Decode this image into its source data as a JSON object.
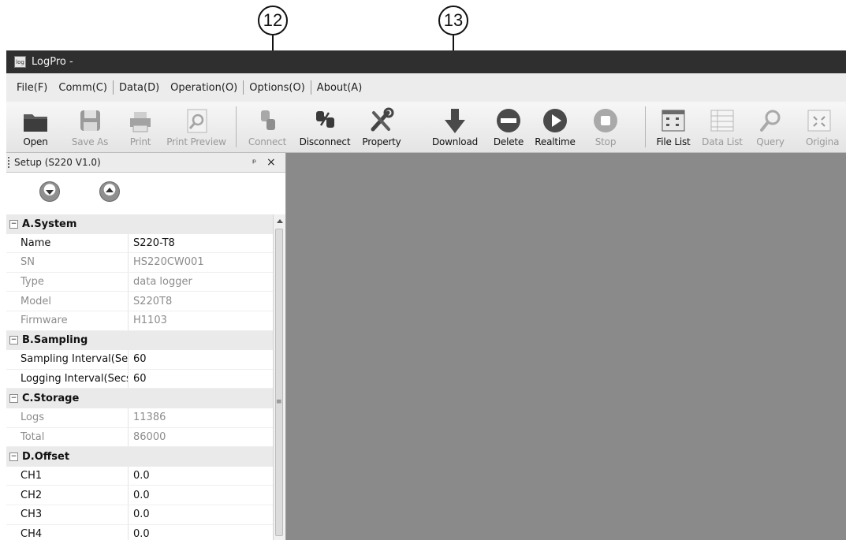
{
  "callouts": [
    {
      "label": "12"
    },
    {
      "label": "13"
    }
  ],
  "window": {
    "title": "LogPro -",
    "icon_text": "log"
  },
  "menu": [
    "File(F)",
    "Comm(C)",
    "Data(D)",
    "Operation(O)",
    "Options(O)",
    "About(A)"
  ],
  "toolbar": [
    {
      "label": "Open",
      "icon": "folder-icon",
      "enabled": true
    },
    {
      "label": "Save As",
      "icon": "save-icon",
      "enabled": false
    },
    {
      "label": "Print",
      "icon": "print-icon",
      "enabled": false
    },
    {
      "label": "Print Preview",
      "icon": "print-preview-icon",
      "enabled": false
    },
    {
      "label": "Connect",
      "icon": "connect-icon",
      "enabled": false
    },
    {
      "label": "Disconnect",
      "icon": "disconnect-icon",
      "enabled": true
    },
    {
      "label": "Property",
      "icon": "property-icon",
      "enabled": true
    },
    {
      "label": "Download",
      "icon": "download-icon",
      "enabled": true
    },
    {
      "label": "Delete",
      "icon": "delete-icon",
      "enabled": true
    },
    {
      "label": "Realtime",
      "icon": "realtime-icon",
      "enabled": true
    },
    {
      "label": "Stop",
      "icon": "stop-icon",
      "enabled": false
    },
    {
      "label": "File List",
      "icon": "file-list-icon",
      "enabled": true
    },
    {
      "label": "Data List",
      "icon": "data-list-icon",
      "enabled": false
    },
    {
      "label": "Query",
      "icon": "query-icon",
      "enabled": false
    },
    {
      "label": "Origina",
      "icon": "original-icon",
      "enabled": false
    }
  ],
  "panel": {
    "title": "Setup (S220 V1.0)",
    "pin_glyph": "ᵖ",
    "close_glyph": "×",
    "tools": [
      "read-settings-icon",
      "write-settings-icon"
    ]
  },
  "properties": [
    {
      "category": "A.System",
      "items": [
        {
          "key": "Name",
          "value": "S220-T8",
          "style": "dark"
        },
        {
          "key": "SN",
          "value": "HS220CW001",
          "style": "lite"
        },
        {
          "key": "Type",
          "value": "data logger",
          "style": "lite"
        },
        {
          "key": "Model",
          "value": "S220T8",
          "style": "lite"
        },
        {
          "key": "Firmware",
          "value": "H1103",
          "style": "lite"
        }
      ]
    },
    {
      "category": "B.Sampling",
      "items": [
        {
          "key": "Sampling Interval(Secs",
          "value": "60",
          "style": "dark"
        },
        {
          "key": "Logging Interval(Secs)",
          "value": "60",
          "style": "dark"
        }
      ]
    },
    {
      "category": "C.Storage",
      "items": [
        {
          "key": "Logs",
          "value": "11386",
          "style": "lite"
        },
        {
          "key": "Total",
          "value": "86000",
          "style": "lite"
        }
      ]
    },
    {
      "category": "D.Offset",
      "items": [
        {
          "key": "CH1",
          "value": "0.0",
          "style": "dark"
        },
        {
          "key": "CH2",
          "value": "0.0",
          "style": "dark"
        },
        {
          "key": "CH3",
          "value": "0.0",
          "style": "dark"
        },
        {
          "key": "CH4",
          "value": "0.0",
          "style": "dark"
        }
      ]
    }
  ],
  "colors": {
    "workarea": "#8a8a8a",
    "titlebar": "#2f2f2f"
  }
}
